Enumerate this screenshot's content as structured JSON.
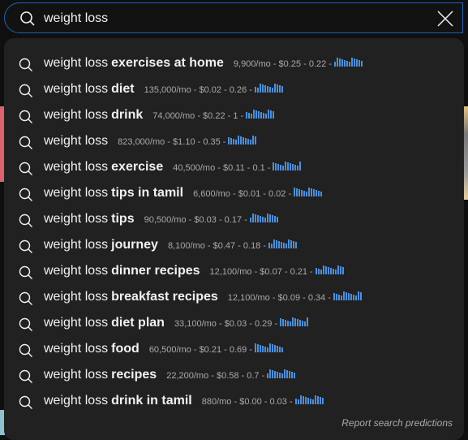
{
  "search": {
    "value": "weight loss",
    "icon": "search-icon",
    "clear_icon": "close-icon"
  },
  "suggestions": [
    {
      "base": "weight loss",
      "suffix": "exercises at home",
      "stats": "9,900/mo - $0.25 - 0.22 -"
    },
    {
      "base": "weight loss",
      "suffix": "diet",
      "stats": "135,000/mo - $0.02 - 0.26 -"
    },
    {
      "base": "weight loss",
      "suffix": "drink",
      "stats": "74,000/mo - $0.22 - 1 -"
    },
    {
      "base": "weight loss",
      "suffix": "",
      "stats": "823,000/mo - $1.10 - 0.35 -"
    },
    {
      "base": "weight loss",
      "suffix": "exercise",
      "stats": "40,500/mo - $0.11 - 0.1 -"
    },
    {
      "base": "weight loss",
      "suffix": "tips in tamil",
      "stats": "6,600/mo - $0.01 - 0.02 -"
    },
    {
      "base": "weight loss",
      "suffix": "tips",
      "stats": "90,500/mo - $0.03 - 0.17 -"
    },
    {
      "base": "weight loss",
      "suffix": "journey",
      "stats": "8,100/mo - $0.47 - 0.18 -"
    },
    {
      "base": "weight loss",
      "suffix": "dinner recipes",
      "stats": "12,100/mo - $0.07 - 0.21 -"
    },
    {
      "base": "weight loss",
      "suffix": "breakfast recipes",
      "stats": "12,100/mo - $0.09 - 0.34 -"
    },
    {
      "base": "weight loss",
      "suffix": "diet plan",
      "stats": "33,100/mo - $0.03 - 0.29 -"
    },
    {
      "base": "weight loss",
      "suffix": "food",
      "stats": "60,500/mo - $0.21 - 0.69 -"
    },
    {
      "base": "weight loss",
      "suffix": "recipes",
      "stats": "22,200/mo - $0.58 - 0.7 -"
    },
    {
      "base": "weight loss",
      "suffix": "drink in tamil",
      "stats": "880/mo - $0.00 - 0.03 -"
    }
  ],
  "report_label": "Report search predictions",
  "colors": {
    "accent": "#1c62b9",
    "trend_bar": "#4a8fdc",
    "dropdown_bg": "#212121"
  }
}
